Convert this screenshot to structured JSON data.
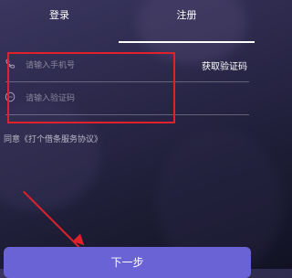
{
  "tabs": {
    "login": "登录",
    "register": "注册"
  },
  "form": {
    "phone": {
      "icon": "phone-icon",
      "value": "",
      "placeholder": "请输入手机号"
    },
    "code": {
      "icon": "message-icon",
      "value": "",
      "placeholder": "请输入验证码"
    },
    "get_code_label": "获取验证码"
  },
  "agreement_text": "同意《打个借条服务协议》",
  "next_button_label": "下一步",
  "colors": {
    "highlight": "#e0202a",
    "button": "#6a63d6"
  }
}
